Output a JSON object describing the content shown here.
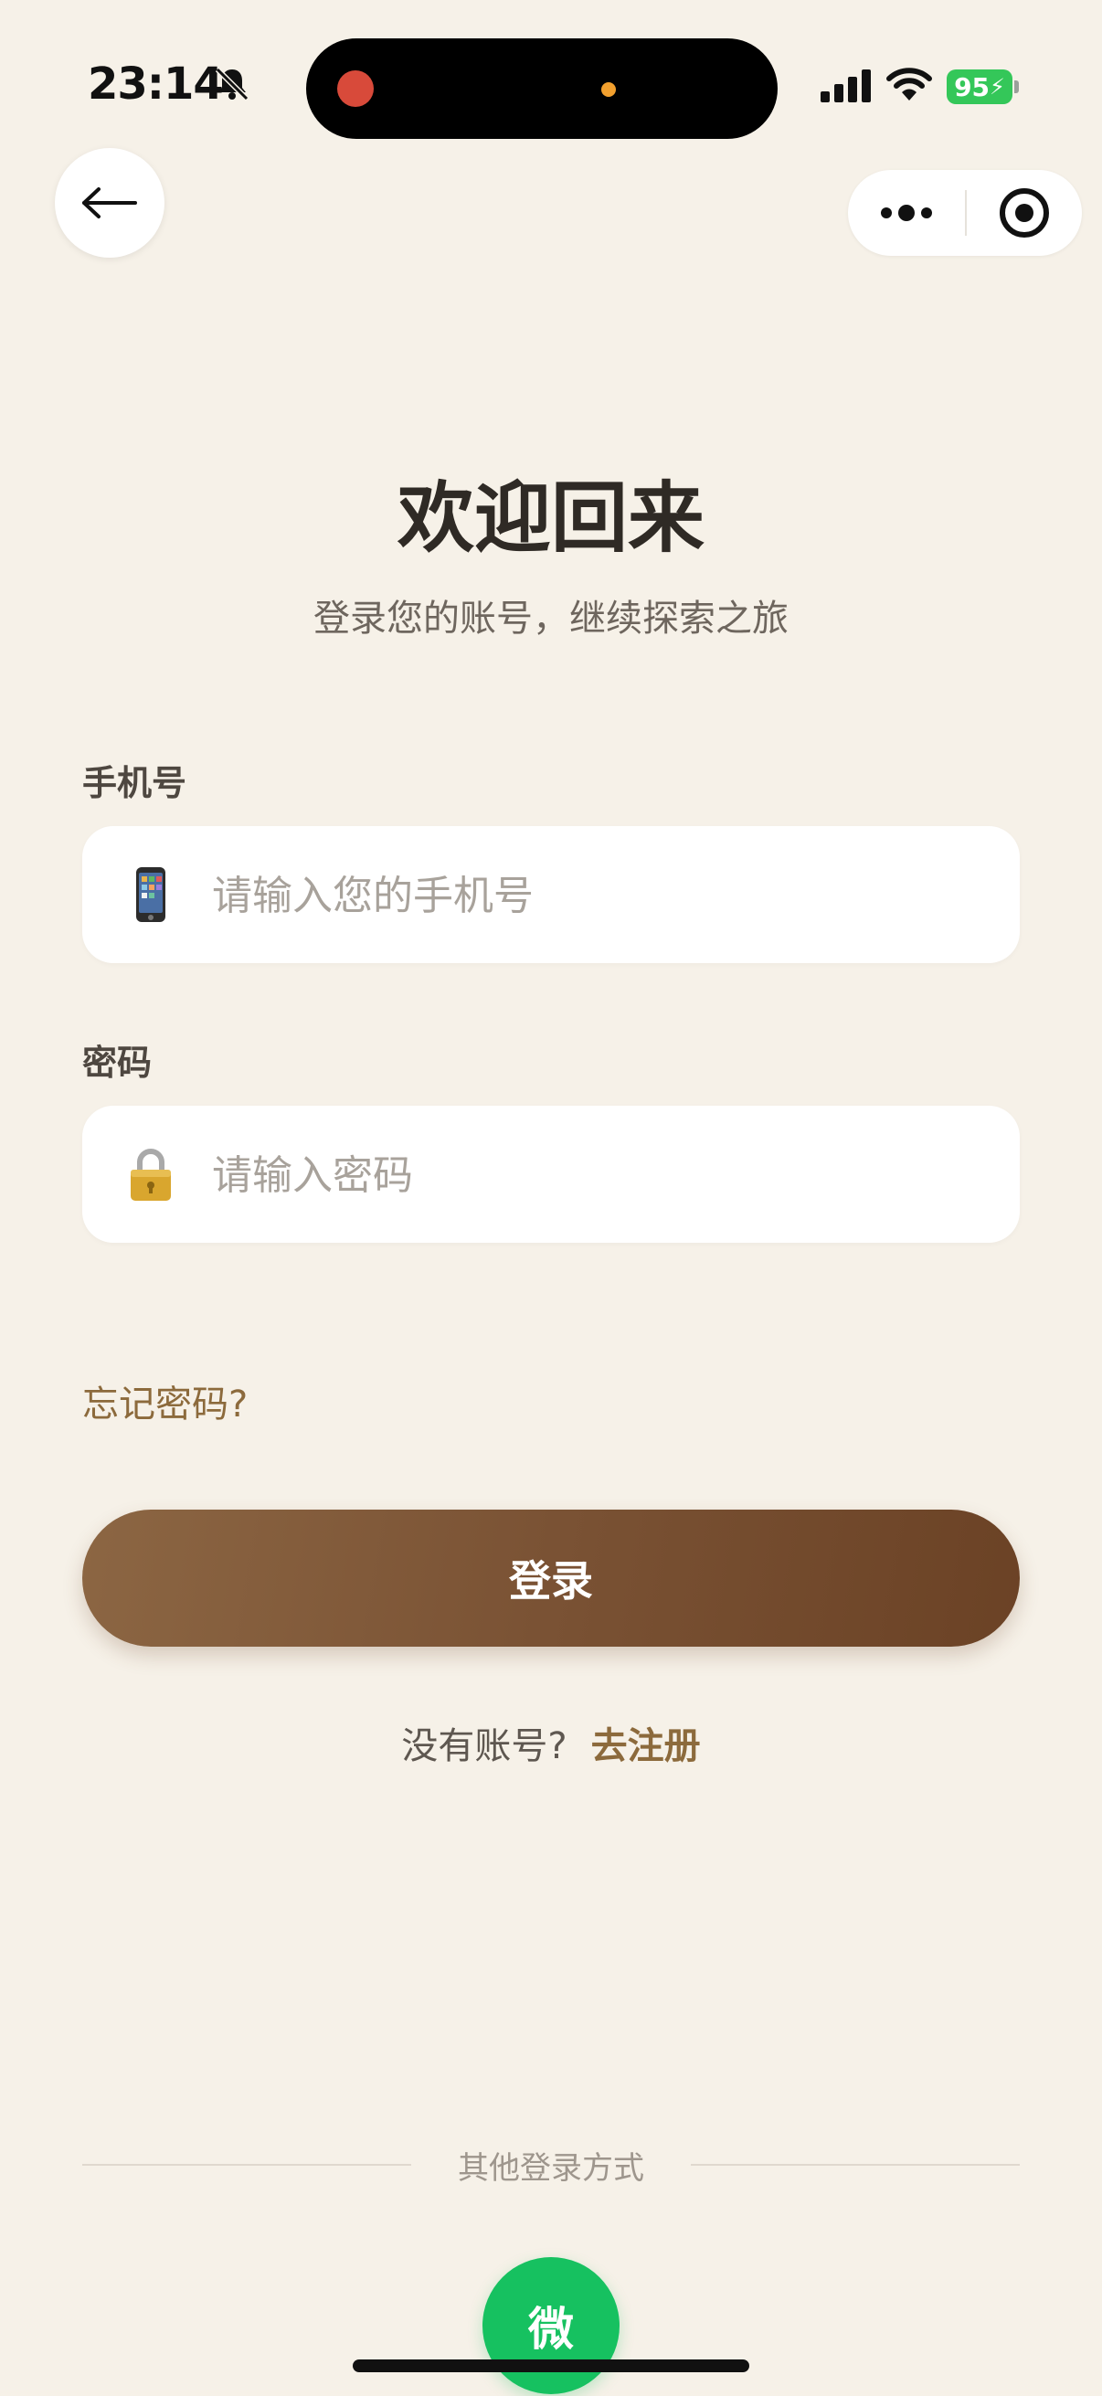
{
  "status_bar": {
    "time": "23:14",
    "battery": "95",
    "icons": [
      "bell-slash-icon",
      "signal-icon",
      "wifi-icon",
      "battery-charging-icon"
    ]
  },
  "nav": {
    "back_icon": "arrow-left-icon",
    "more_icon": "more-dots-icon",
    "close_icon": "target-close-icon"
  },
  "header": {
    "title": "欢迎回来",
    "subtitle": "登录您的账号，继续探索之旅"
  },
  "form": {
    "phone": {
      "label": "手机号",
      "placeholder": "请输入您的手机号",
      "value": "",
      "icon": "mobile-phone-icon"
    },
    "password": {
      "label": "密码",
      "placeholder": "请输入密码",
      "value": "",
      "icon": "lock-icon"
    },
    "forgot": "忘记密码?",
    "login_button": "登录"
  },
  "register": {
    "prompt": "没有账号?",
    "link": "去注册"
  },
  "other_login": {
    "label": "其他登录方式",
    "wechat": "微"
  },
  "colors": {
    "background": "#F6F1E8",
    "accent_brown": "#7A5234",
    "link": "#8C6A3C",
    "wechat_green": "#16C160"
  }
}
